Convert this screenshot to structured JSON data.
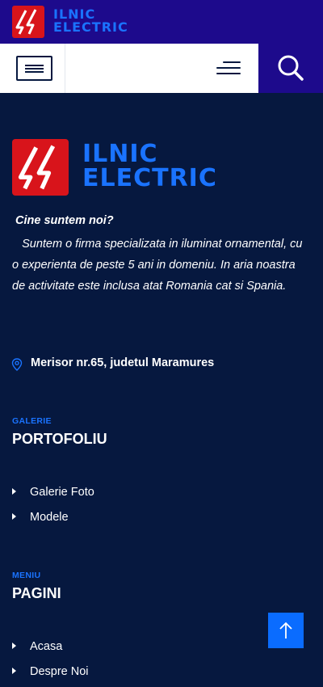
{
  "header": {
    "brand_line1": "ILNIC",
    "brand_line2": "ELECTRIC",
    "logo_icon": "lightning-bolt-icon",
    "brand_color": "#1a73ff",
    "bar_color": "#1d0a8c"
  },
  "nav": {
    "menu_icon": "menu-toggle-icon",
    "hamburger_icon": "hamburger-icon",
    "search_icon": "search-icon"
  },
  "footer": {
    "brand_line1": "ILNIC",
    "brand_line2": "ELECTRIC",
    "about_title": "Cine suntem noi?",
    "about_text": "Suntem o firma specializata in iluminat ornamental, cu o experienta de peste 5 ani in domeniu. In aria noastra de activitate este inclusa atat Romania cat si Spania.",
    "address": "Merisor nr.65, judetul Maramures",
    "address_icon": "map-pin-icon",
    "portfolio": {
      "kicker": "GALERIE",
      "heading": "PORTOFOLIU",
      "links": [
        "Galerie Foto",
        "Modele"
      ]
    },
    "pages": {
      "kicker": "MENIU",
      "heading": "PAGINI",
      "links": [
        "Acasa",
        "Despre Noi"
      ]
    },
    "background_color": "#06183f"
  },
  "back_to_top": {
    "icon": "arrow-up-icon",
    "color": "#0a6cff"
  }
}
